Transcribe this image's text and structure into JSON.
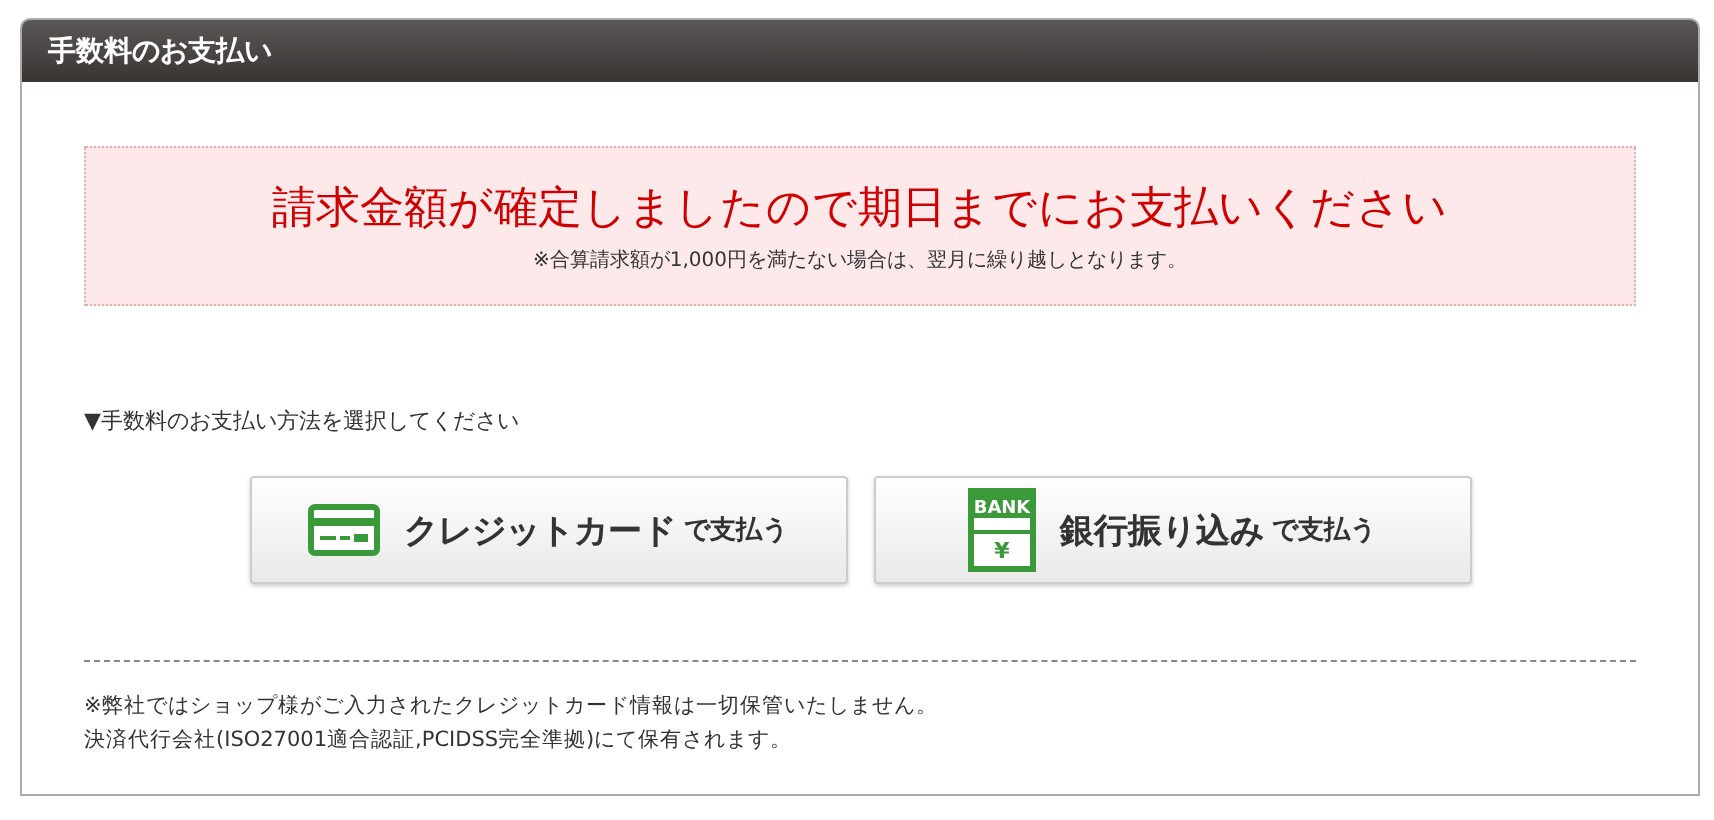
{
  "panel": {
    "title": "手数料のお支払い"
  },
  "notice": {
    "headline": "請求金額が確定しましたので期日までにお支払いください",
    "note": "※合算請求額が1,000円を満たない場合は、翌月に繰り越しとなります。"
  },
  "prompt": "▼手数料のお支払い方法を選択してください",
  "methods": [
    {
      "kind": "card",
      "label": "クレジットカード",
      "suffix": "で支払う"
    },
    {
      "kind": "bank",
      "label": "銀行振り込み",
      "suffix": "で支払う",
      "icon_texts": [
        "BANK",
        "¥"
      ]
    }
  ],
  "footnotes": [
    "※弊社ではショップ様がご入力されたクレジットカード情報は一切保管いたしません。",
    "決済代行会社(ISO27001適合認証,PCIDSS完全準拠)にて保有されます。"
  ]
}
